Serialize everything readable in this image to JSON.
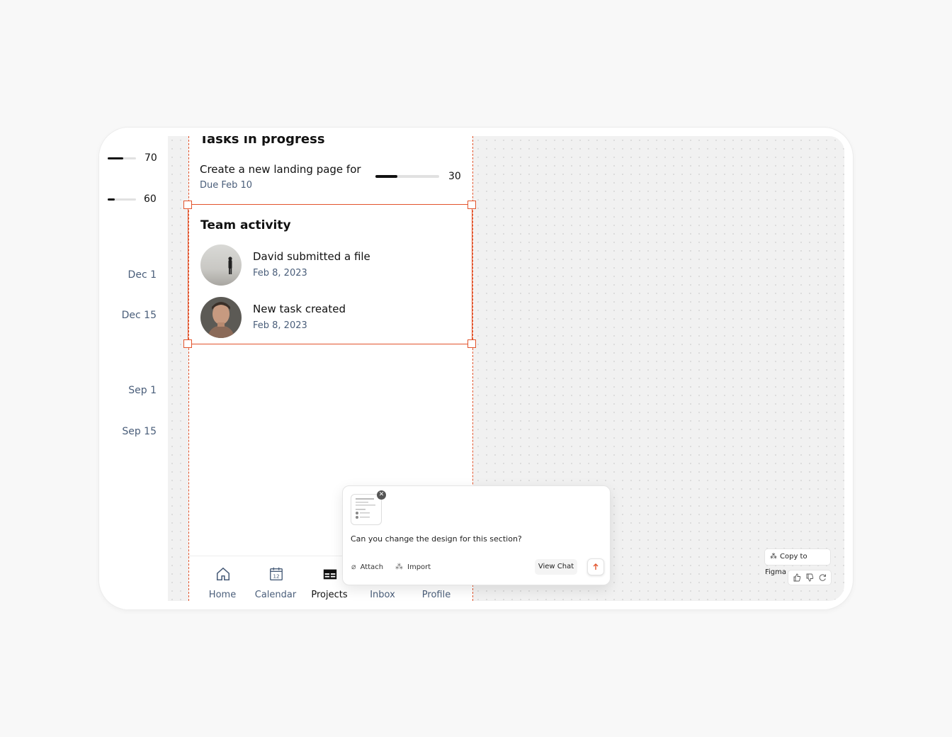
{
  "left_column": {
    "progress_items": [
      {
        "value": "70",
        "fill": 0.55
      },
      {
        "value": "60",
        "fill": 0.25
      }
    ],
    "dates": [
      "Dec 1",
      "Dec 15",
      "Sep 1",
      "Sep 15"
    ]
  },
  "phone": {
    "section_title_cut": "Tasks in progress",
    "task": {
      "title": "Create a new landing page for",
      "due": "Due Feb 10",
      "progress_value": "30",
      "progress_fill": 0.34
    },
    "team_activity": {
      "title": "Team activity",
      "items": [
        {
          "title": "David submitted a file",
          "date": "Feb 8, 2023",
          "avatar": "person-landscape-avatar"
        },
        {
          "title": "New task created",
          "date": "Feb 8, 2023",
          "avatar": "man-portrait-avatar"
        }
      ]
    },
    "nav": [
      {
        "label": "Home",
        "icon": "home-icon",
        "active": false
      },
      {
        "label": "Calendar",
        "icon": "calendar-icon",
        "active": false
      },
      {
        "label": "Projects",
        "icon": "projects-icon",
        "active": true
      },
      {
        "label": "Inbox",
        "icon": "inbox-icon",
        "active": false
      },
      {
        "label": "Profile",
        "icon": "profile-icon",
        "active": false
      }
    ],
    "calendar_icon_day": "12"
  },
  "chat": {
    "message": "Can you change the design for this section?",
    "attach_label": "Attach",
    "import_label": "Import",
    "view_chat_label": "View Chat"
  },
  "canvas_tools": {
    "copy_figma_label": "Copy to Figma"
  },
  "colors": {
    "accent": "#e2542c",
    "muted_text": "#4a5e7a"
  }
}
